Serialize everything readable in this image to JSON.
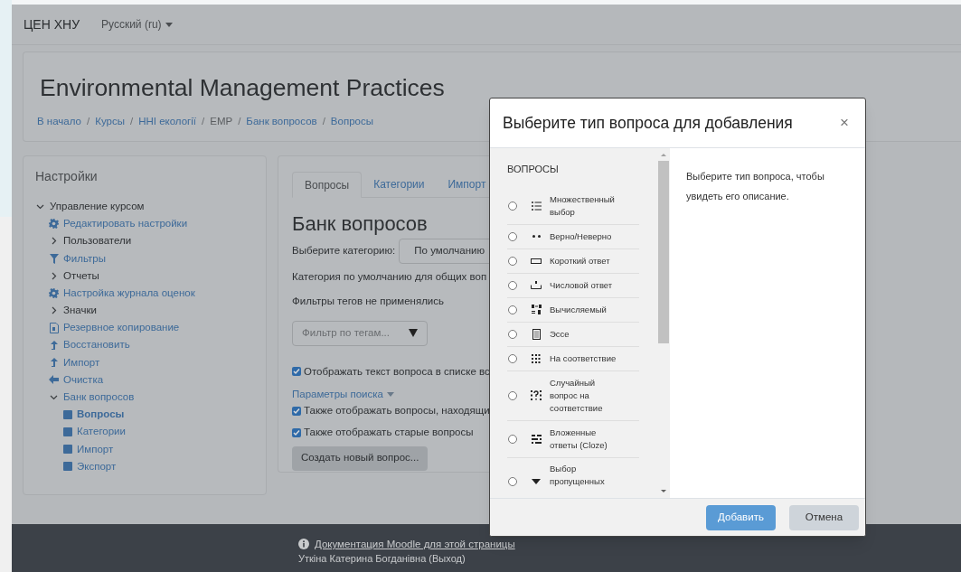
{
  "navbar": {
    "brand": "ЦЕН ХНУ",
    "language": "Русский (ru)"
  },
  "header": {
    "title": "Environmental Management Practices",
    "separator": "/",
    "breadcrumbs": [
      {
        "label": "В начало",
        "link": true
      },
      {
        "label": "Курсы",
        "link": true
      },
      {
        "label": "ННІ екології",
        "link": true
      },
      {
        "label": "EMP",
        "link": false
      },
      {
        "label": "Банк вопросов",
        "link": true
      },
      {
        "label": "Вопросы",
        "link": true
      }
    ]
  },
  "settings": {
    "title": "Настройки",
    "tree": [
      {
        "label": "Управление курсом",
        "kind": "folder",
        "expanded": true,
        "children": [
          {
            "label": "Редактировать настройки",
            "kind": "settings"
          },
          {
            "label": "Пользователи",
            "kind": "folder",
            "expanded": false
          },
          {
            "label": "Фильтры",
            "kind": "filter"
          },
          {
            "label": "Отчеты",
            "kind": "folder",
            "expanded": false
          },
          {
            "label": "Настройка журнала оценок",
            "kind": "settings"
          },
          {
            "label": "Значки",
            "kind": "folder",
            "expanded": false
          },
          {
            "label": "Резервное копирование",
            "kind": "backup"
          },
          {
            "label": "Восстановить",
            "kind": "upload"
          },
          {
            "label": "Импорт",
            "kind": "upload"
          },
          {
            "label": "Очистка",
            "kind": "back"
          },
          {
            "label": "Банк вопросов",
            "kind": "folder",
            "expanded": true,
            "children": [
              {
                "label": "Вопросы",
                "kind": "page",
                "selected": true
              },
              {
                "label": "Категории",
                "kind": "page",
                "selected": false
              },
              {
                "label": "Импорт",
                "kind": "page",
                "selected": false
              },
              {
                "label": "Экспорт",
                "kind": "page",
                "selected": false
              }
            ]
          }
        ]
      }
    ]
  },
  "question_bank": {
    "tabs": [
      {
        "label": "Вопросы",
        "selected": true
      },
      {
        "label": "Категории",
        "selected": false
      },
      {
        "label": "Импорт",
        "selected": false
      }
    ],
    "heading": "Банк вопросов",
    "category_label": "Выберите категорию:",
    "category_value": "По умолчанию",
    "category_info": "Категория по умолчанию для общих воп",
    "tag_info": "Фильтры тегов не применялись",
    "tag_filter": {
      "placeholder": "Фильтр по тегам..."
    },
    "show_text": {
      "label": "Отображать текст вопроса в списке вс",
      "checked": true
    },
    "search_options": "Параметры поиска",
    "options": [
      {
        "label": "Также отображать вопросы, находящи",
        "checked": true
      },
      {
        "label": "Также отображать старые вопросы",
        "checked": true
      }
    ],
    "create_button": "Создать новый вопрос..."
  },
  "modal": {
    "title": "Выберите тип вопроса для добавления",
    "close": "×",
    "section": "ВОПРОСЫ",
    "types": [
      {
        "label": "Множественный выбор",
        "kind": "multichoice",
        "selected": false
      },
      {
        "label": "Верно/Неверно",
        "kind": "truefalse",
        "selected": false
      },
      {
        "label": "Короткий ответ",
        "kind": "shortanswer",
        "selected": false
      },
      {
        "label": "Числовой ответ",
        "kind": "numerical",
        "selected": false
      },
      {
        "label": "Вычисляемый",
        "kind": "calculated",
        "selected": false
      },
      {
        "label": "Эссе",
        "kind": "essay",
        "selected": false
      },
      {
        "label": "На соответствие",
        "kind": "match",
        "selected": false
      },
      {
        "label": "Случайный вопрос на соответствие",
        "kind": "randommatch",
        "selected": false
      },
      {
        "label": "Вложенные ответы (Cloze)",
        "kind": "cloze",
        "selected": false
      },
      {
        "label": "Выбор пропущенных",
        "kind": "gapselect",
        "selected": false
      }
    ],
    "description": "Выберите тип вопроса, чтобы увидеть его описание.",
    "buttons": [
      {
        "label": "Добавить",
        "kind": "primary"
      },
      {
        "label": "Отмена",
        "kind": "secondary"
      }
    ]
  },
  "footer": {
    "docs_link": "Документация Moodle для этой страницы",
    "user": "Уткіна Катерина Богданівна (Выход)"
  }
}
